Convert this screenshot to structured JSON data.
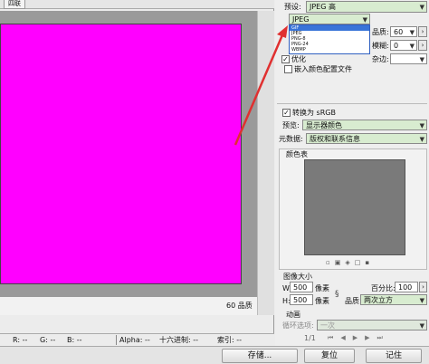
{
  "tab": {
    "label": "四联"
  },
  "canvas": {
    "fill_color": "#ff00ff",
    "frame_color": "#9a9a9a"
  },
  "quality_readout": "60 品质",
  "status_bar": {
    "r_label": "R:",
    "r_value": "--",
    "g_label": "G:",
    "g_value": "--",
    "b_label": "B:",
    "b_value": "--",
    "alpha_label": "Alpha:",
    "alpha_value": "--",
    "hex_label": "十六进制:",
    "hex_value": "--",
    "index_label": "索引:",
    "index_value": "--"
  },
  "buttons": {
    "save": "存储...",
    "reset": "复位",
    "remember": "记住"
  },
  "preset": {
    "label": "预设:",
    "value": "JPEG 高"
  },
  "format": {
    "selected": "JPEG",
    "options": [
      "GIF",
      "JPEG",
      "PNG-8",
      "PNG-24",
      "WBMP"
    ],
    "highlighted": "GIF"
  },
  "options": {
    "quality_label": "品质:",
    "quality_value": "60",
    "blur_label": "模糊:",
    "blur_value": "0",
    "matte_label": "杂边:",
    "optimized_label": "优化",
    "embed_profile_label": "嵌入颜色配置文件"
  },
  "srgb": {
    "label": "转换为 sRGB",
    "checked": true
  },
  "preview": {
    "label": "预览:",
    "value": "显示器颜色"
  },
  "metadata": {
    "label": "元数据:",
    "value": "版权和联系信息"
  },
  "color_table": {
    "title": "颜色表",
    "swatch_color": "#7a7a7a"
  },
  "image_size": {
    "title": "图像大小",
    "w_label": "W:",
    "w_value": "500",
    "w_unit": "像素",
    "h_label": "H:",
    "h_value": "500",
    "h_unit": "像素",
    "percent_label": "百分比:",
    "percent_value": "100",
    "quality_label": "品质:",
    "quality_value": "两次立方"
  },
  "animation": {
    "title": "动画",
    "loop_label": "循环选项:",
    "loop_value": "一次",
    "frame_counter": "1/1"
  }
}
